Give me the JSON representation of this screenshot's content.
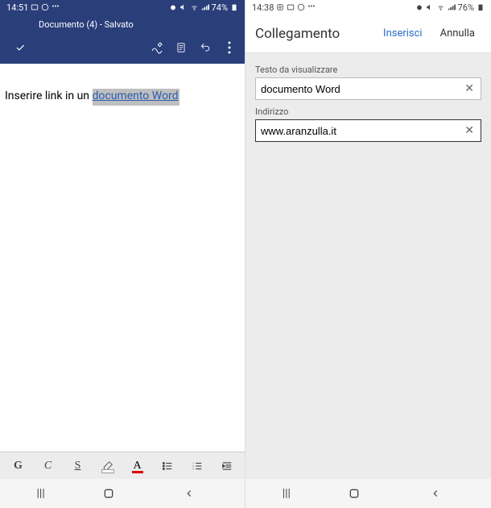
{
  "left": {
    "status": {
      "time": "14:51",
      "battery": "74%"
    },
    "header": {
      "title": "Documento (4) - Salvato"
    },
    "document": {
      "text_before": "Inserire link in un ",
      "link_text": "documento Word"
    },
    "format": {
      "bold": "G",
      "italic": "C",
      "underline": "S",
      "fontcolor": "A"
    }
  },
  "right": {
    "status": {
      "time": "14:38",
      "battery": "76%"
    },
    "dialog": {
      "title": "Collegamento",
      "insert": "Inserisci",
      "cancel": "Annulla",
      "display_label": "Testo da visualizzare",
      "display_value": "documento Word",
      "address_label": "Indirizzo",
      "address_value": "www.aranzulla.it"
    }
  }
}
